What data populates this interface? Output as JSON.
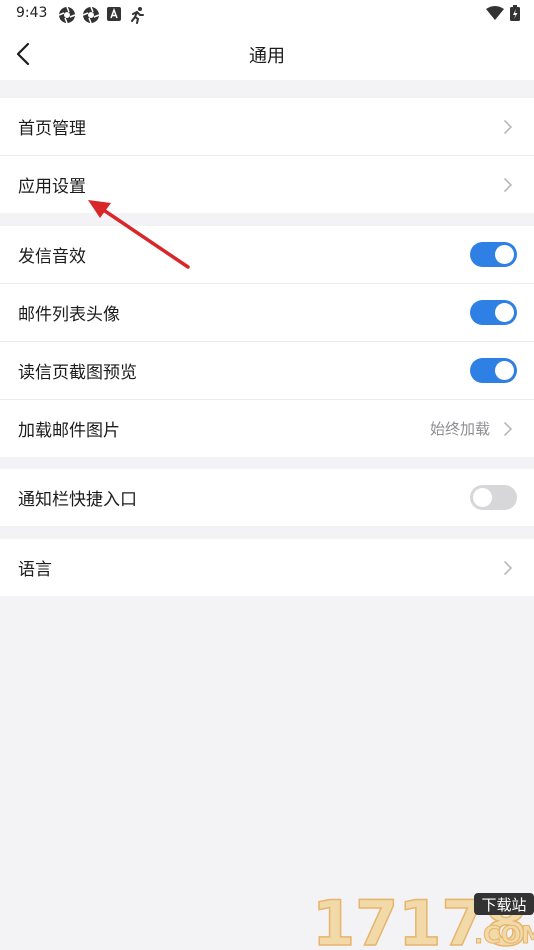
{
  "status_bar": {
    "time": "9:43"
  },
  "header": {
    "title": "通用"
  },
  "groups": [
    {
      "items": [
        {
          "label": "首页管理",
          "type": "link"
        },
        {
          "label": "应用设置",
          "type": "link"
        }
      ]
    },
    {
      "items": [
        {
          "label": "发信音效",
          "type": "toggle",
          "on": true
        },
        {
          "label": "邮件列表头像",
          "type": "toggle",
          "on": true
        },
        {
          "label": "读信页截图预览",
          "type": "toggle",
          "on": true
        },
        {
          "label": "加载邮件图片",
          "type": "link",
          "value": "始终加载"
        }
      ]
    },
    {
      "items": [
        {
          "label": "通知栏快捷入口",
          "type": "toggle",
          "on": false
        }
      ]
    },
    {
      "items": [
        {
          "label": "语言",
          "type": "link"
        }
      ]
    }
  ],
  "watermark": {
    "text": "17178",
    "badge": "下载站",
    "suffix": ".COM"
  },
  "colors": {
    "accent": "#2f80e4",
    "annotation_arrow": "#d9262b",
    "background": "#f3f3f5"
  }
}
